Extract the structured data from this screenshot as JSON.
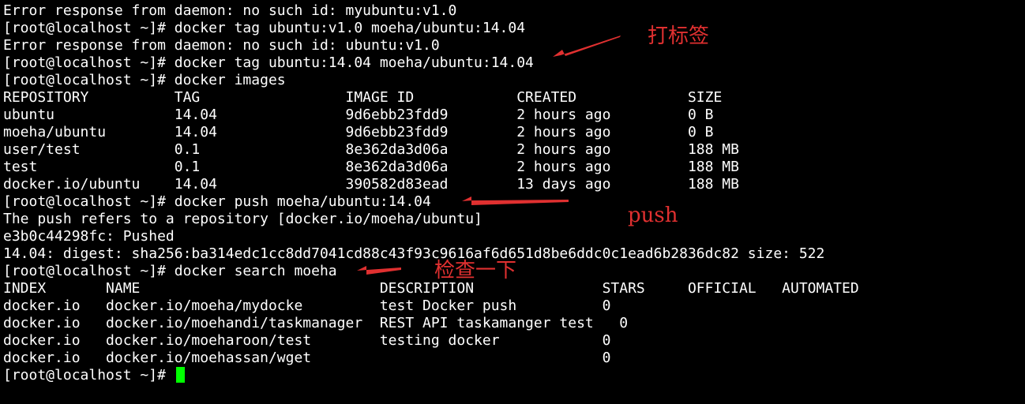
{
  "terminal": {
    "lines": [
      "Error response from daemon: no such id: myubuntu:v1.0",
      "[root@localhost ~]# docker tag ubuntu:v1.0 moeha/ubuntu:14.04",
      "Error response from daemon: no such id: ubuntu:v1.0",
      "[root@localhost ~]# docker tag ubuntu:14.04 moeha/ubuntu:14.04",
      "[root@localhost ~]# docker images",
      "REPOSITORY          TAG                 IMAGE ID            CREATED             SIZE",
      "ubuntu              14.04               9d6ebb23fdd9        2 hours ago         0 B",
      "moeha/ubuntu        14.04               9d6ebb23fdd9        2 hours ago         0 B",
      "user/test           0.1                 8e362da3d06a        2 hours ago         188 MB",
      "test                0.1                 8e362da3d06a        2 hours ago         188 MB",
      "docker.io/ubuntu    14.04               390582d83ead        13 days ago         188 MB",
      "[root@localhost ~]# docker push moeha/ubuntu:14.04",
      "The push refers to a repository [docker.io/moeha/ubuntu]",
      "e3b0c44298fc: Pushed",
      "14.04: digest: sha256:ba314edc1cc8dd7041cd88c43f93c9616af6d651d8be6ddc0c1ead6b2836dc82 size: 522",
      "[root@localhost ~]# docker search moeha",
      "INDEX       NAME                            DESCRIPTION               STARS     OFFICIAL   AUTOMATED",
      "docker.io   docker.io/moeha/mydocke         test Docker push          0",
      "docker.io   docker.io/moehandi/taskmanager  REST API taskamanger test   0",
      "docker.io   docker.io/moeharoon/test        testing docker            0",
      "docker.io   docker.io/moehassan/wget                                  0"
    ],
    "prompt": "[root@localhost ~]# ",
    "cursor_color": "#00ff00"
  },
  "annotations": {
    "tag_label": "打标签",
    "push_label": "push",
    "search_label": "检查一下",
    "color": "#e03030"
  }
}
